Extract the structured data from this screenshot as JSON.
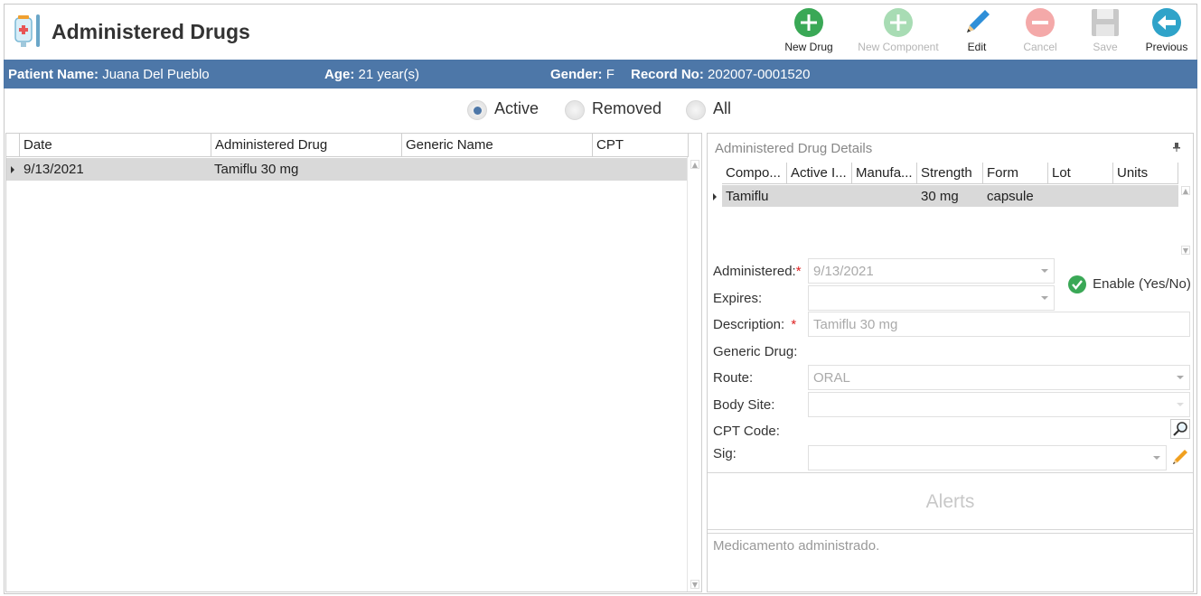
{
  "header": {
    "title": "Administered Drugs",
    "app_icon": "iv-bag-icon"
  },
  "toolbar": {
    "new_drug": "New Drug",
    "new_component": "New Component",
    "edit": "Edit",
    "cancel": "Cancel",
    "save": "Save",
    "previous": "Previous"
  },
  "patient": {
    "name_label": "Patient Name:",
    "name": "Juana Del Pueblo",
    "age_label": "Age:",
    "age": "21 year(s)",
    "gender_label": "Gender:",
    "gender": "F",
    "record_label": "Record No:",
    "record": "202007-0001520"
  },
  "filters": {
    "active": "Active",
    "removed": "Removed",
    "all": "All",
    "selected": "Active"
  },
  "grid": {
    "columns": [
      "Date",
      "Administered Drug",
      "Generic Name",
      "CPT"
    ],
    "rows": [
      {
        "date": "9/13/2021",
        "drug": "Tamiflu 30 mg",
        "generic": "",
        "cpt": ""
      }
    ]
  },
  "details": {
    "title": "Administered Drug Details",
    "components": {
      "columns": [
        "Compo...",
        "Active I...",
        "Manufa...",
        "Strength",
        "Form",
        "Lot",
        "Units"
      ],
      "rows": [
        {
          "component": "Tamiflu",
          "active": "",
          "manufacturer": "",
          "strength": "30 mg",
          "form": "capsule",
          "lot": "",
          "units": ""
        }
      ]
    },
    "administered_label": "Administered:",
    "administered_value": "9/13/2021",
    "expires_label": "Expires:",
    "expires_value": "",
    "enable_label": "Enable (Yes/No)",
    "description_label": "Description:",
    "description_value": "Tamiflu 30 mg",
    "generic_label": "Generic Drug:",
    "route_label": "Route:",
    "route_value": "ORAL",
    "body_site_label": "Body Site:",
    "body_site_value": "",
    "cpt_label": "CPT Code:",
    "sig_label": "Sig:",
    "sig_value": "",
    "alerts_label": "Alerts",
    "notes_placeholder": "Medicamento administrado."
  },
  "colors": {
    "accent": "#4d77a8",
    "green": "#3aa856",
    "selected_row": "#d9d9d9"
  }
}
